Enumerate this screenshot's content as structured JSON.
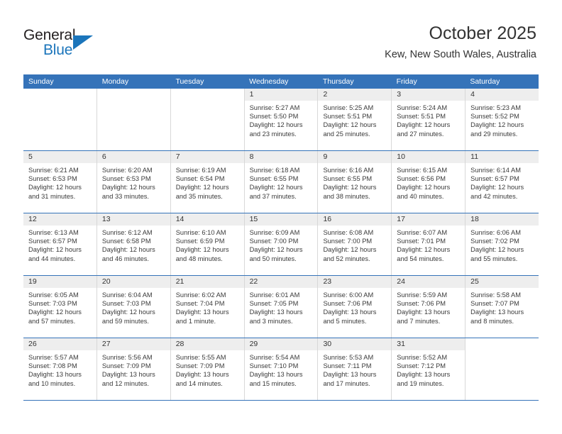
{
  "brand": {
    "name_part1": "General",
    "name_part2": "Blue",
    "logo_icon": "blue-triangle-icon"
  },
  "header": {
    "title": "October 2025",
    "location": "Kew, New South Wales, Australia"
  },
  "colors": {
    "header_row_bg": "#3573b9",
    "day_number_bg": "#eeeeee",
    "brand_blue": "#1b75bb",
    "text": "#333333",
    "cell_divider": "#d8d8d8"
  },
  "weekdays": [
    "Sunday",
    "Monday",
    "Tuesday",
    "Wednesday",
    "Thursday",
    "Friday",
    "Saturday"
  ],
  "labels": {
    "sunrise_prefix": "Sunrise:",
    "sunset_prefix": "Sunset:",
    "daylight_prefix": "Daylight:"
  },
  "weeks": [
    [
      {
        "day": "",
        "blank": true,
        "lines": []
      },
      {
        "day": "",
        "blank": true,
        "lines": []
      },
      {
        "day": "",
        "blank": true,
        "lines": []
      },
      {
        "day": "1",
        "lines": [
          "Sunrise: 5:27 AM",
          "Sunset: 5:50 PM",
          "Daylight: 12 hours and 23 minutes."
        ]
      },
      {
        "day": "2",
        "lines": [
          "Sunrise: 5:25 AM",
          "Sunset: 5:51 PM",
          "Daylight: 12 hours and 25 minutes."
        ]
      },
      {
        "day": "3",
        "lines": [
          "Sunrise: 5:24 AM",
          "Sunset: 5:51 PM",
          "Daylight: 12 hours and 27 minutes."
        ]
      },
      {
        "day": "4",
        "lines": [
          "Sunrise: 5:23 AM",
          "Sunset: 5:52 PM",
          "Daylight: 12 hours and 29 minutes."
        ]
      }
    ],
    [
      {
        "day": "5",
        "lines": [
          "Sunrise: 6:21 AM",
          "Sunset: 6:53 PM",
          "Daylight: 12 hours and 31 minutes."
        ]
      },
      {
        "day": "6",
        "lines": [
          "Sunrise: 6:20 AM",
          "Sunset: 6:53 PM",
          "Daylight: 12 hours and 33 minutes."
        ]
      },
      {
        "day": "7",
        "lines": [
          "Sunrise: 6:19 AM",
          "Sunset: 6:54 PM",
          "Daylight: 12 hours and 35 minutes."
        ]
      },
      {
        "day": "8",
        "lines": [
          "Sunrise: 6:18 AM",
          "Sunset: 6:55 PM",
          "Daylight: 12 hours and 37 minutes."
        ]
      },
      {
        "day": "9",
        "lines": [
          "Sunrise: 6:16 AM",
          "Sunset: 6:55 PM",
          "Daylight: 12 hours and 38 minutes."
        ]
      },
      {
        "day": "10",
        "lines": [
          "Sunrise: 6:15 AM",
          "Sunset: 6:56 PM",
          "Daylight: 12 hours and 40 minutes."
        ]
      },
      {
        "day": "11",
        "lines": [
          "Sunrise: 6:14 AM",
          "Sunset: 6:57 PM",
          "Daylight: 12 hours and 42 minutes."
        ]
      }
    ],
    [
      {
        "day": "12",
        "lines": [
          "Sunrise: 6:13 AM",
          "Sunset: 6:57 PM",
          "Daylight: 12 hours and 44 minutes."
        ]
      },
      {
        "day": "13",
        "lines": [
          "Sunrise: 6:12 AM",
          "Sunset: 6:58 PM",
          "Daylight: 12 hours and 46 minutes."
        ]
      },
      {
        "day": "14",
        "lines": [
          "Sunrise: 6:10 AM",
          "Sunset: 6:59 PM",
          "Daylight: 12 hours and 48 minutes."
        ]
      },
      {
        "day": "15",
        "lines": [
          "Sunrise: 6:09 AM",
          "Sunset: 7:00 PM",
          "Daylight: 12 hours and 50 minutes."
        ]
      },
      {
        "day": "16",
        "lines": [
          "Sunrise: 6:08 AM",
          "Sunset: 7:00 PM",
          "Daylight: 12 hours and 52 minutes."
        ]
      },
      {
        "day": "17",
        "lines": [
          "Sunrise: 6:07 AM",
          "Sunset: 7:01 PM",
          "Daylight: 12 hours and 54 minutes."
        ]
      },
      {
        "day": "18",
        "lines": [
          "Sunrise: 6:06 AM",
          "Sunset: 7:02 PM",
          "Daylight: 12 hours and 55 minutes."
        ]
      }
    ],
    [
      {
        "day": "19",
        "lines": [
          "Sunrise: 6:05 AM",
          "Sunset: 7:03 PM",
          "Daylight: 12 hours and 57 minutes."
        ]
      },
      {
        "day": "20",
        "lines": [
          "Sunrise: 6:04 AM",
          "Sunset: 7:03 PM",
          "Daylight: 12 hours and 59 minutes."
        ]
      },
      {
        "day": "21",
        "lines": [
          "Sunrise: 6:02 AM",
          "Sunset: 7:04 PM",
          "Daylight: 13 hours and 1 minute."
        ]
      },
      {
        "day": "22",
        "lines": [
          "Sunrise: 6:01 AM",
          "Sunset: 7:05 PM",
          "Daylight: 13 hours and 3 minutes."
        ]
      },
      {
        "day": "23",
        "lines": [
          "Sunrise: 6:00 AM",
          "Sunset: 7:06 PM",
          "Daylight: 13 hours and 5 minutes."
        ]
      },
      {
        "day": "24",
        "lines": [
          "Sunrise: 5:59 AM",
          "Sunset: 7:06 PM",
          "Daylight: 13 hours and 7 minutes."
        ]
      },
      {
        "day": "25",
        "lines": [
          "Sunrise: 5:58 AM",
          "Sunset: 7:07 PM",
          "Daylight: 13 hours and 8 minutes."
        ]
      }
    ],
    [
      {
        "day": "26",
        "lines": [
          "Sunrise: 5:57 AM",
          "Sunset: 7:08 PM",
          "Daylight: 13 hours and 10 minutes."
        ]
      },
      {
        "day": "27",
        "lines": [
          "Sunrise: 5:56 AM",
          "Sunset: 7:09 PM",
          "Daylight: 13 hours and 12 minutes."
        ]
      },
      {
        "day": "28",
        "lines": [
          "Sunrise: 5:55 AM",
          "Sunset: 7:09 PM",
          "Daylight: 13 hours and 14 minutes."
        ]
      },
      {
        "day": "29",
        "lines": [
          "Sunrise: 5:54 AM",
          "Sunset: 7:10 PM",
          "Daylight: 13 hours and 15 minutes."
        ]
      },
      {
        "day": "30",
        "lines": [
          "Sunrise: 5:53 AM",
          "Sunset: 7:11 PM",
          "Daylight: 13 hours and 17 minutes."
        ]
      },
      {
        "day": "31",
        "lines": [
          "Sunrise: 5:52 AM",
          "Sunset: 7:12 PM",
          "Daylight: 13 hours and 19 minutes."
        ]
      },
      {
        "day": "",
        "blank": true,
        "lines": []
      }
    ]
  ]
}
